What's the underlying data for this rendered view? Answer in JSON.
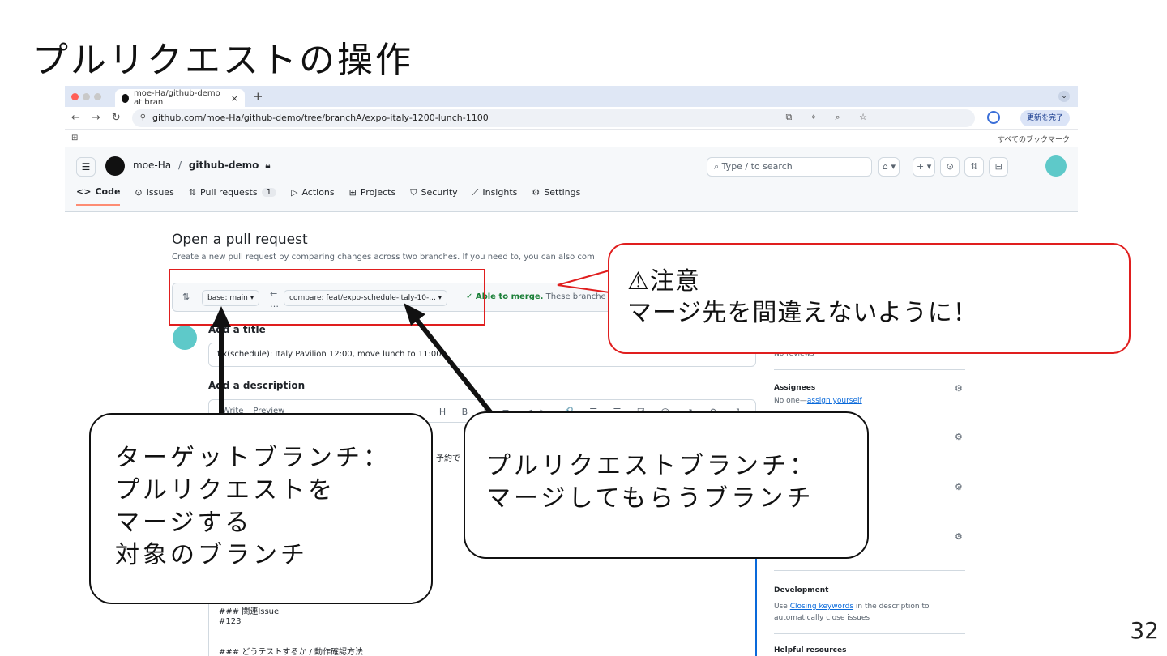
{
  "slide": {
    "title": "プルリクエストの操作",
    "page_number": "32"
  },
  "browser": {
    "tab_title": "moe-Ha/github-demo at bran",
    "tab_close": "×",
    "new_tab": "+",
    "url": "github.com/moe-Ha/github-demo/tree/branchA/expo-italy-1200-lunch-1100",
    "update_button": "更新を完了",
    "bookmarks_all": "すべてのブックマーク"
  },
  "github": {
    "owner": "moe-Ha",
    "separator": "/",
    "repo": "github-demo",
    "search_placeholder": "Type / to search",
    "nav": [
      {
        "label": "Code",
        "icon": "code-icon",
        "glyph": "<>"
      },
      {
        "label": "Issues",
        "icon": "issue-icon",
        "glyph": "⊙"
      },
      {
        "label": "Pull requests",
        "icon": "pull-request-icon",
        "glyph": "⇅",
        "count": "1"
      },
      {
        "label": "Actions",
        "icon": "play-icon",
        "glyph": "▷"
      },
      {
        "label": "Projects",
        "icon": "table-icon",
        "glyph": "⊞"
      },
      {
        "label": "Security",
        "icon": "shield-icon",
        "glyph": "⛉"
      },
      {
        "label": "Insights",
        "icon": "graph-icon",
        "glyph": "⟋"
      },
      {
        "label": "Settings",
        "icon": "gear-icon",
        "glyph": "⚙"
      }
    ]
  },
  "pr": {
    "heading": "Open a pull request",
    "description": "Create a new pull request by comparing changes across two branches. If you need to, you can also com",
    "base_branch": "base: main ▾",
    "compare_branch": "compare: feat/expo-schedule-italy-10-... ▾",
    "merge_status": "✓ Able to merge.",
    "merge_status_rest": "These branche",
    "add_title_label": "Add a title",
    "title_value": "fix(schedule): Italy Pavilion 12:00, move lunch to 11:00",
    "add_description_label": "Add a description",
    "editor_tab_write": "Write",
    "editor_tab_preview": "Preview",
    "editor_tools": "H B I ≡ <> 🔗 ☰ ☰ ☑ @ ↗ ↶ ⤢",
    "desc_fragment": "予約で",
    "desc_related_heading": "### 関連Issue",
    "desc_related_issue": "#123",
    "desc_test_heading": "### どうテストするか / 動作確認方法"
  },
  "sidebar": {
    "no_reviews": "No reviews",
    "assignees_heading": "Assignees",
    "assignees_text": "No one—",
    "assign_yourself": "assign yourself",
    "development_heading": "Development",
    "development_pre": "Use ",
    "closing_keywords": "Closing keywords",
    "development_post": " in the description to automatically close issues",
    "helpful_heading": "Helpful resources"
  },
  "annotations": {
    "warning_line1": "⚠注意",
    "warning_line2": "マージ先を間違えないように！",
    "target_line1": "ターゲットブランチ：",
    "target_line2": "プルリクエストを",
    "target_line3": "マージする",
    "target_line4": "対象のブランチ",
    "pr_line1": "プルリクエストブランチ：",
    "pr_line2": "マージしてもらうブランチ"
  },
  "colors": {
    "annotation_red": "#e01e1e",
    "merge_green": "#1a7f37",
    "active_tab_underline": "#fd8c73",
    "link_blue": "#0969da"
  }
}
